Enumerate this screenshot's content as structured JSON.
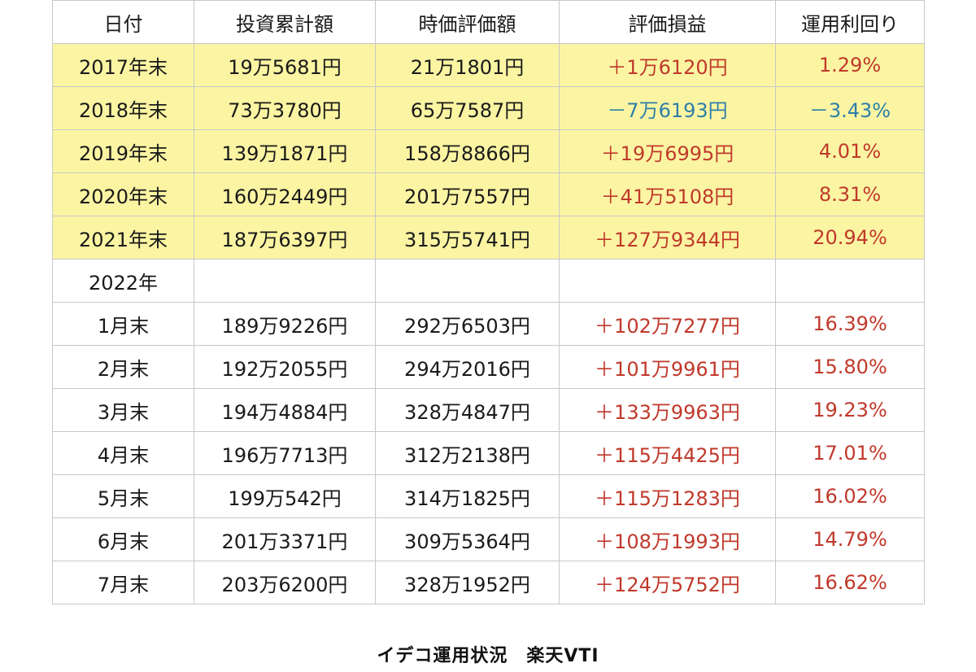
{
  "table": {
    "headers": [
      "日付",
      "投資累計額",
      "時価評価額",
      "評価損益",
      "運用利回り"
    ],
    "rows": [
      {
        "cells": [
          "2017年末",
          "19万5681円",
          "21万1801円",
          "＋1万6120円",
          "1.29%"
        ],
        "highlight": true,
        "sign": "pos"
      },
      {
        "cells": [
          "2018年末",
          "73万3780円",
          "65万7587円",
          "－7万6193円",
          "－3.43%"
        ],
        "highlight": true,
        "sign": "neg"
      },
      {
        "cells": [
          "2019年末",
          "139万1871円",
          "158万8866円",
          "＋19万6995円",
          "4.01%"
        ],
        "highlight": true,
        "sign": "pos"
      },
      {
        "cells": [
          "2020年末",
          "160万2449円",
          "201万7557円",
          "＋41万5108円",
          "8.31%"
        ],
        "highlight": true,
        "sign": "pos"
      },
      {
        "cells": [
          "2021年末",
          "187万6397円",
          "315万5741円",
          "＋127万9344円",
          "20.94%"
        ],
        "highlight": true,
        "sign": "pos"
      },
      {
        "cells": [
          "2022年",
          "",
          "",
          "",
          ""
        ],
        "highlight": false,
        "sign": ""
      },
      {
        "cells": [
          "1月末",
          "189万9226円",
          "292万6503円",
          "＋102万7277円",
          "16.39%"
        ],
        "highlight": false,
        "sign": "pos"
      },
      {
        "cells": [
          "2月末",
          "192万2055円",
          "294万2016円",
          "＋101万9961円",
          "15.80%"
        ],
        "highlight": false,
        "sign": "pos"
      },
      {
        "cells": [
          "3月末",
          "194万4884円",
          "328万4847円",
          "＋133万9963円",
          "19.23%"
        ],
        "highlight": false,
        "sign": "pos"
      },
      {
        "cells": [
          "4月末",
          "196万7713円",
          "312万2138円",
          "＋115万4425円",
          "17.01%"
        ],
        "highlight": false,
        "sign": "pos"
      },
      {
        "cells": [
          "5月末",
          "199万542円",
          "314万1825円",
          "＋115万1283円",
          "16.02%"
        ],
        "highlight": false,
        "sign": "pos"
      },
      {
        "cells": [
          "6月末",
          "201万3371円",
          "309万5364円",
          "＋108万1993円",
          "14.79%"
        ],
        "highlight": false,
        "sign": "pos"
      },
      {
        "cells": [
          "7月末",
          "203万6200円",
          "328万1952円",
          "＋124万5752円",
          "16.62%"
        ],
        "highlight": false,
        "sign": "pos"
      }
    ]
  },
  "caption": "イデコ運用状況　楽天VTI",
  "colors": {
    "highlight_row": "#fbf5a3",
    "positive": "#c0392b",
    "negative": "#2e7ea8",
    "grid": "#c8c8c8"
  }
}
